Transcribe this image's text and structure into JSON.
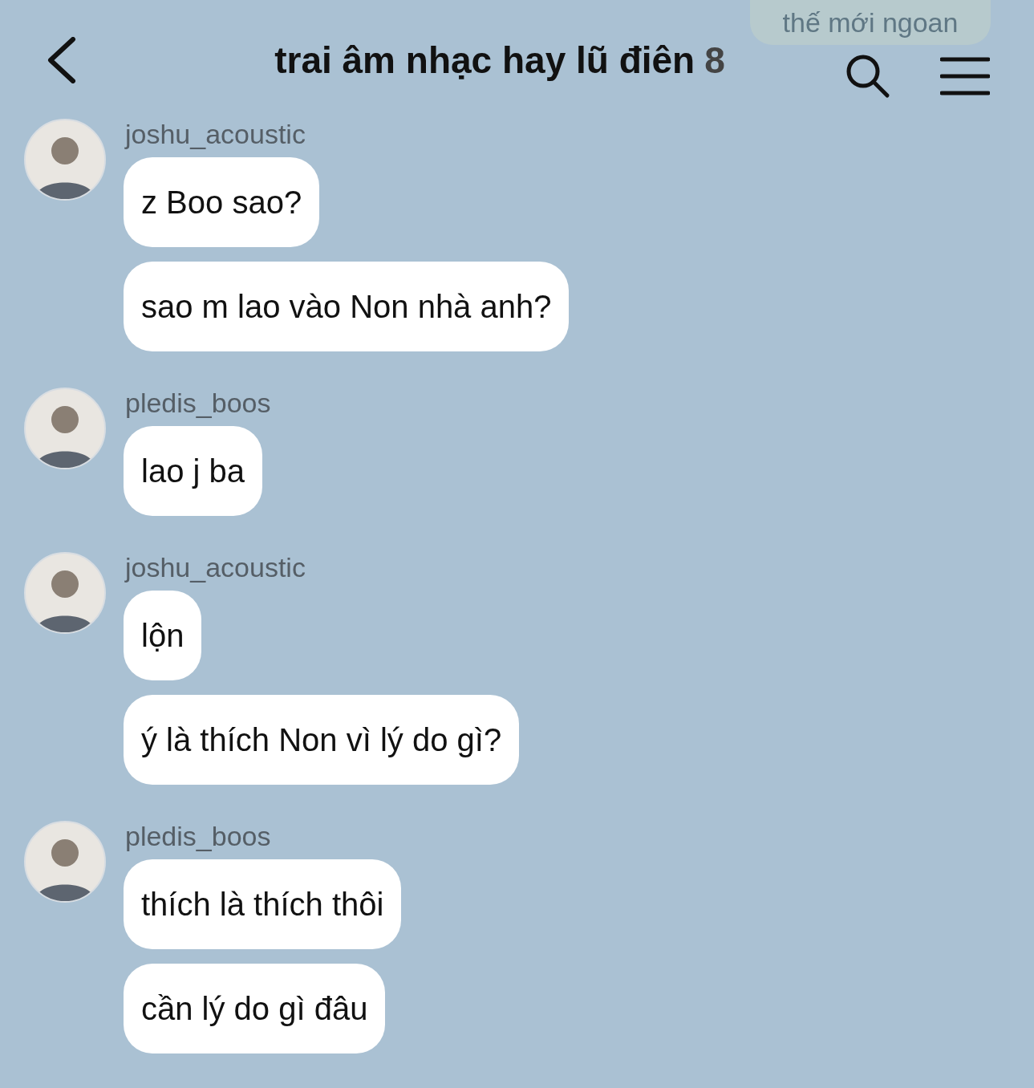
{
  "header": {
    "title": "trai âm nhạc hay lũ điên",
    "member_count": "8"
  },
  "faded_message": {
    "text": "thế mới ngoan"
  },
  "groups": [
    {
      "sender": "joshu_acoustic",
      "messages": [
        "z Boo sao?",
        "sao m lao vào Non nhà anh?"
      ]
    },
    {
      "sender": "pledis_boos",
      "messages": [
        "lao j ba"
      ]
    },
    {
      "sender": "joshu_acoustic",
      "messages": [
        "lộn",
        "ý là thích Non vì lý do gì?"
      ]
    },
    {
      "sender": "pledis_boos",
      "messages": [
        "thích là thích thôi",
        "cần lý do gì đâu"
      ]
    }
  ]
}
